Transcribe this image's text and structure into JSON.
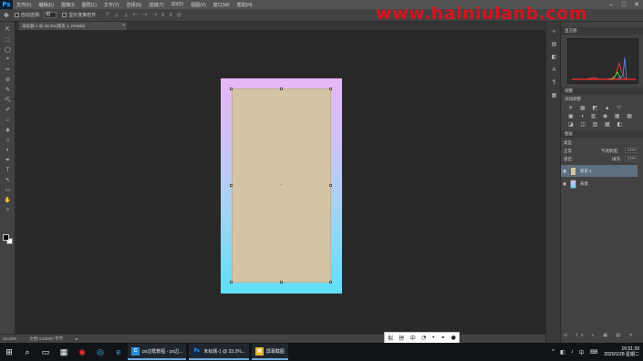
{
  "app": {
    "logo": "Ps"
  },
  "menu": [
    "文件(F)",
    "编辑(E)",
    "图像(I)",
    "图层(L)",
    "文字(Y)",
    "选择(S)",
    "滤镜(T)",
    "3D(D)",
    "视图(V)",
    "窗口(W)",
    "帮助(H)"
  ],
  "window_controls": {
    "minimize": "–",
    "maximize": "□",
    "close": "✕"
  },
  "options_bar": {
    "auto_select_label": "自动选择:",
    "auto_select_value": "组",
    "show_transform_label": "显示变换控件"
  },
  "document_tab": {
    "title": "未标题-1 @ 33.3%(矩形 1, RGB/8)",
    "close": "×"
  },
  "tools": [
    "⇱",
    "⬚",
    "◯",
    "⌖",
    "✂",
    "⊘",
    "✎",
    "⛏",
    "✐",
    "♧",
    "◈",
    "⌂",
    "◐",
    "✒",
    "T",
    "↖",
    "▭",
    "✋",
    "⌕"
  ],
  "status_bar": {
    "zoom": "33.33%",
    "doc_info": "文档:3.52M/0 字节",
    "arrow": "▸"
  },
  "panels": {
    "histogram_tab": "直方图",
    "adjustments_tab": "调整",
    "adjustments_title": "添加调整",
    "adj_row1": "☀ ▦ ◩ ▲ ▽",
    "adj_row2": "▣ ◑ ▥ ◉ ▦ ▦",
    "adj_row3": "◪ ◫ ▨ ▩ ◧",
    "layers_tab": "图层",
    "kind_label": "类型",
    "blend_mode": "正常",
    "opacity_label": "不透明度:",
    "opacity_value": "100%",
    "lock_label": "锁定:",
    "fill_label": "填充:",
    "fill_value": "100%",
    "layers": [
      {
        "name": "矩形 1",
        "color": "#d4c3a4"
      },
      {
        "name": "背景",
        "color": "#b5a8f0"
      }
    ],
    "footer_icons": "⊝ fx ◐ ▣ ▤ ✕"
  },
  "watermark": "www.hainiulanb.com",
  "ime_toolbar": [
    "拟",
    "拼",
    "中",
    "◔",
    "•",
    "⚭",
    "●"
  ],
  "taskbar": {
    "start_icon": "⊞",
    "search_icon": "⌕",
    "task_view_icon": "▭",
    "pinned": [
      "▦",
      "◉",
      "◎",
      "e"
    ],
    "apps": [
      {
        "icon": "C",
        "label": "ps边框教程 - ps边...",
        "color": "#2a8cd8"
      },
      {
        "icon": "Ps",
        "label": "未标题-1 @ 33.3%...",
        "color": "#0b2a4a"
      },
      {
        "icon": "▤",
        "label": "屏幕截图",
        "color": "#e8b32a"
      }
    ],
    "tray_icons": [
      "^",
      "◧",
      "♪",
      "中",
      "⌨"
    ],
    "time": "16:51:39",
    "date": "2020/1/28 星期二"
  },
  "colors": {
    "canvas_bg": "#282828",
    "panel_bg": "#424242",
    "shape_fill": "#d4c3a4",
    "gradient_top": "#e8b7f5",
    "gradient_bottom": "#5ee0f8",
    "watermark": "#e5101c"
  }
}
